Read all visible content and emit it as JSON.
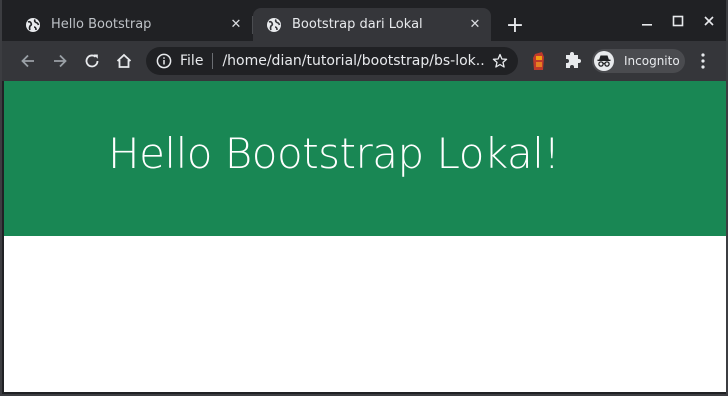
{
  "tabs": [
    {
      "title": "Hello Bootstrap",
      "favicon": "globe-icon",
      "active": false
    },
    {
      "title": "Bootstrap dari Lokal",
      "favicon": "globe-icon",
      "active": true
    }
  ],
  "toolbar": {
    "file_label": "File",
    "url": "/home/dian/tutorial/bootstrap/bs-lok...",
    "incognito_label": "Incognito"
  },
  "page": {
    "heading": "Hello Bootstrap Lokal!"
  },
  "colors": {
    "jumbotron_bg": "#198754",
    "tabstrip_bg": "#202124",
    "toolbar_bg": "#35363a",
    "page_bg": "#ffffff"
  }
}
